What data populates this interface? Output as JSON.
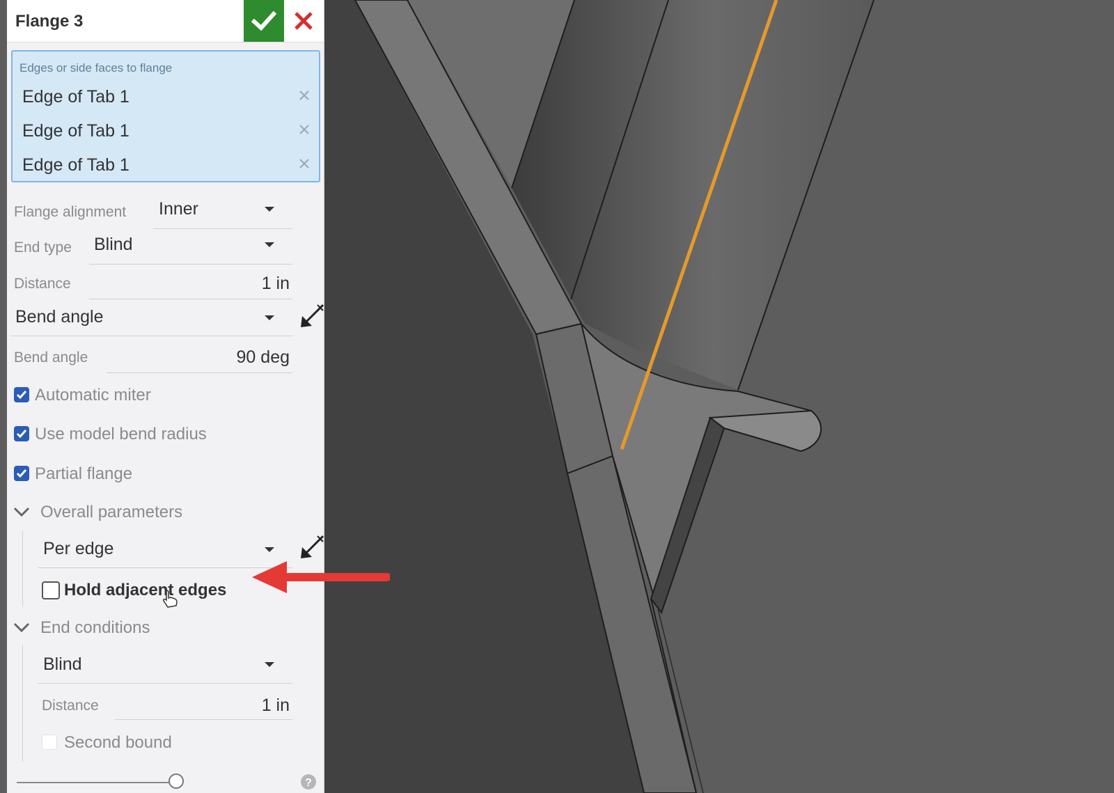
{
  "feature": {
    "title": "Flange 3",
    "confirm_icon": "checkmark-icon",
    "cancel_icon": "close-icon",
    "accent_confirm": "#2e8b2e",
    "accent_cancel": "#d32f2f"
  },
  "selection": {
    "label": "Edges or side faces to flange",
    "items": [
      "Edge of Tab 1",
      "Edge of Tab 1",
      "Edge of Tab 1"
    ]
  },
  "fields": {
    "flange_alignment": {
      "label": "Flange alignment",
      "value": "Inner"
    },
    "end_type": {
      "label": "End type",
      "value": "Blind"
    },
    "distance": {
      "label": "Distance",
      "value": "1 in"
    },
    "angle_mode": {
      "value": "Bend angle"
    },
    "bend_angle": {
      "label": "Bend angle",
      "value": "90 deg"
    }
  },
  "checkboxes": {
    "automatic_miter": {
      "label": "Automatic miter",
      "checked": true
    },
    "use_model_bend_radius": {
      "label": "Use model bend radius",
      "checked": true
    },
    "partial_flange": {
      "label": "Partial flange",
      "checked": true
    }
  },
  "overall_parameters": {
    "title": "Overall parameters",
    "mode": "Per edge",
    "hold_adjacent_edges": {
      "label": "Hold adjacent edges",
      "checked": false
    }
  },
  "end_conditions": {
    "title": "End conditions",
    "type": "Blind",
    "distance": {
      "label": "Distance",
      "value": "1 in"
    },
    "second_bound": {
      "label": "Second bound",
      "checked": false
    }
  },
  "colors": {
    "selected_edge": "#e49a2c",
    "annotation_arrow": "#e53935",
    "checkbox_blue": "#2a5cb8"
  }
}
